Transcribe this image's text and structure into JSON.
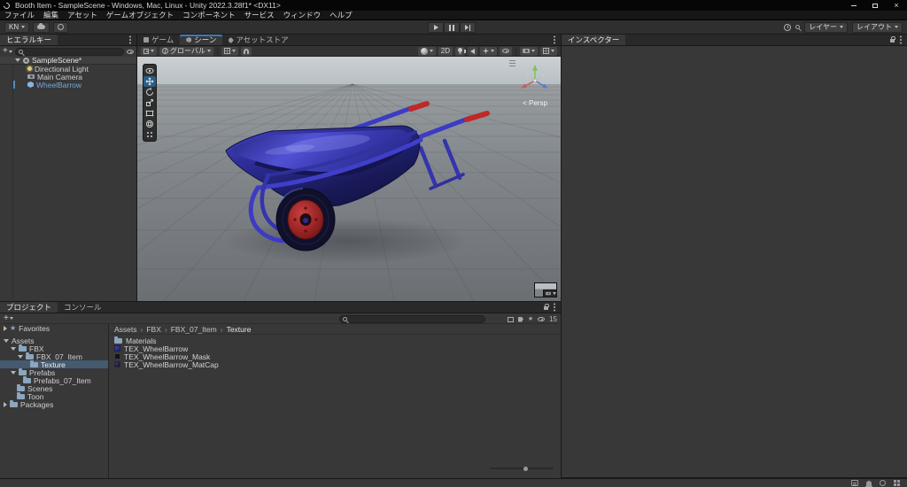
{
  "title_bar": {
    "title": "Booth Item - SampleScene - Windows, Mac, Linux - Unity 2022.3.28f1* <DX11>"
  },
  "menu_bar": {
    "items": [
      "ファイル",
      "編集",
      "アセット",
      "ゲームオブジェクト",
      "コンポーネント",
      "サービス",
      "ウィンドウ",
      "ヘルプ"
    ]
  },
  "toolbar": {
    "account_label": "KN",
    "layers_label": "レイヤー",
    "layout_label": "レイアウト"
  },
  "hierarchy": {
    "tab": "ヒエラルキー",
    "scene_name": "SampleScene*",
    "items": [
      {
        "label": "Directional Light"
      },
      {
        "label": "Main Camera"
      },
      {
        "label": "WheelBarrow"
      }
    ]
  },
  "scene_view": {
    "tabs": [
      {
        "label": "ゲーム"
      },
      {
        "label": "シーン"
      },
      {
        "label": "アセットストア"
      }
    ],
    "toolbar": {
      "handle_orientation": "グローバル",
      "mode_2d": "2D"
    },
    "gizmo_label": "< Persp"
  },
  "inspector": {
    "tab": "インスペクター"
  },
  "project": {
    "tabs": [
      {
        "label": "プロジェクト"
      },
      {
        "label": "コンソール"
      }
    ],
    "breadcrumb": [
      "Assets",
      "FBX",
      "FBX_07_Item",
      "Texture"
    ],
    "tree": [
      {
        "label": "Favorites"
      },
      {
        "label": "Assets"
      },
      {
        "label": "FBX"
      },
      {
        "label": "FBX_07_Item"
      },
      {
        "label": "Texture"
      },
      {
        "label": "Prefabs"
      },
      {
        "label": "Prefabs_07_Item"
      },
      {
        "label": "Scenes"
      },
      {
        "label": "Toon"
      },
      {
        "label": "Packages"
      }
    ],
    "files": [
      {
        "label": "Materials"
      },
      {
        "label": "TEX_WheelBarrow"
      },
      {
        "label": "TEX_WheelBarrow_Mask"
      },
      {
        "label": "TEX_WheelBarrow_MatCap"
      }
    ],
    "hidden_count": "15"
  },
  "glyphs": {
    "close": "×",
    "breadcrumb_sep": "›",
    "favorites_star": "★"
  },
  "colors": {
    "selection_blue": "#2c5d87",
    "prefab_text": "#6fa8dc",
    "wheelbarrow_blue": "#3b3bc4",
    "wheelbarrow_red": "#b42828",
    "axis_x": "#d05858",
    "axis_y": "#84c060",
    "axis_z": "#5878d0"
  }
}
